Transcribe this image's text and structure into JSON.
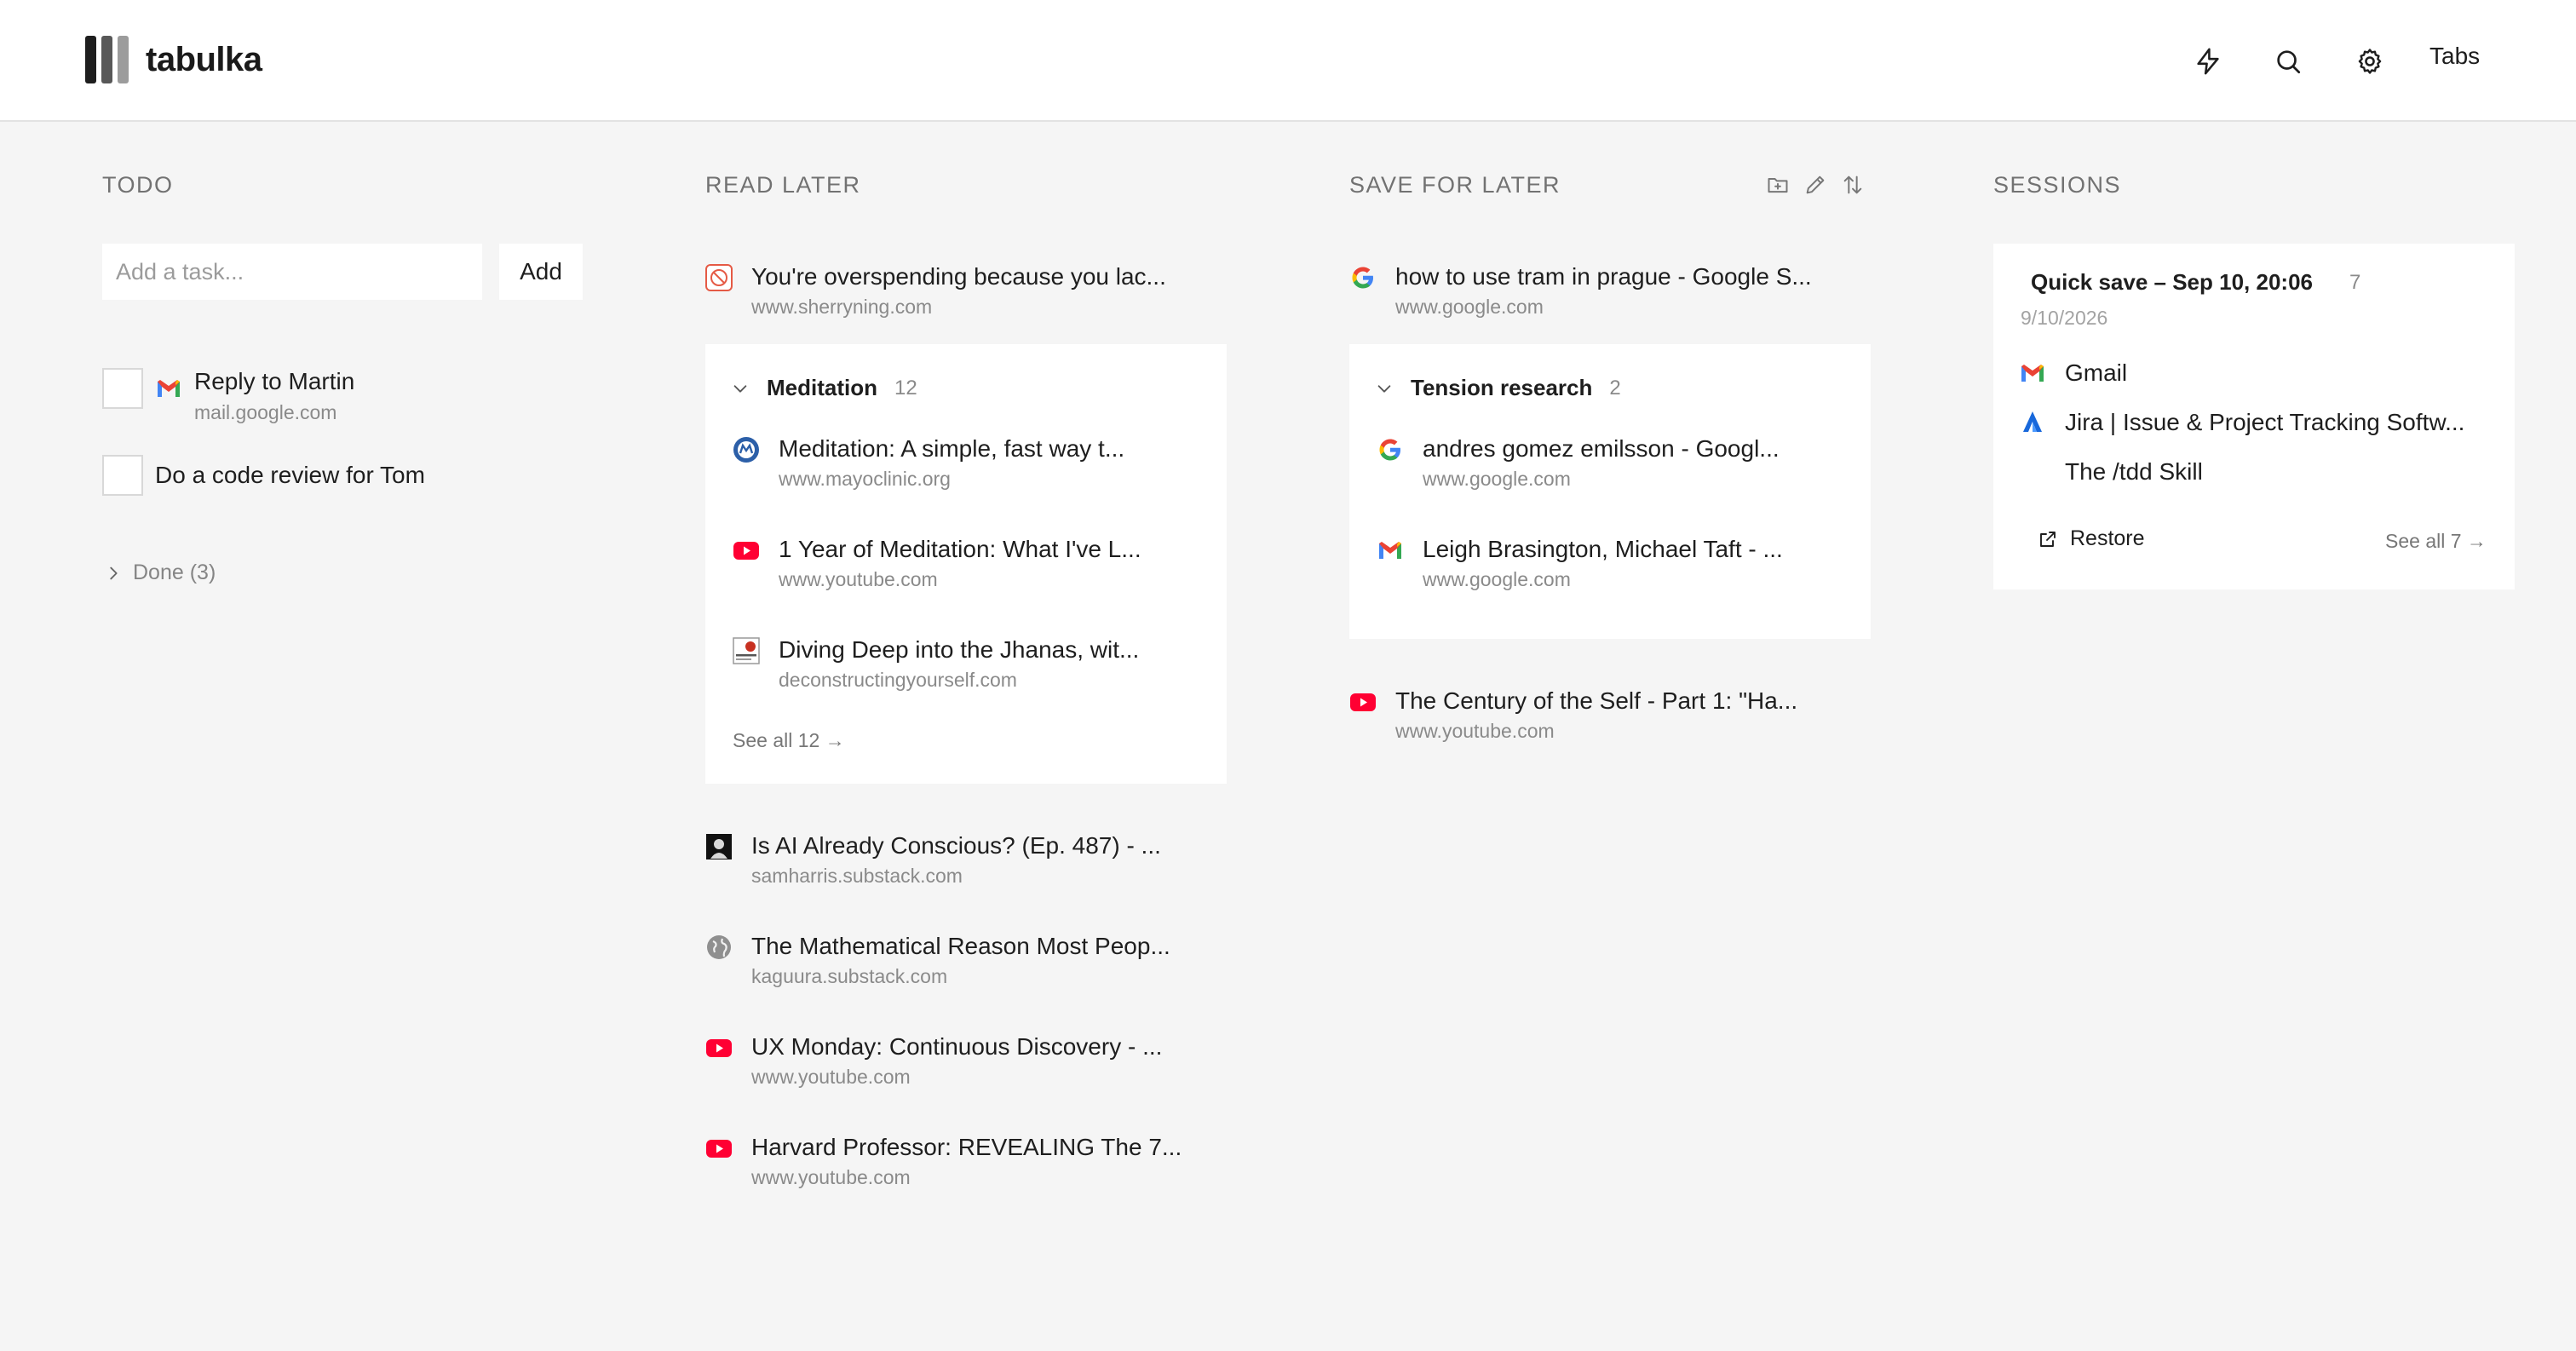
{
  "app": {
    "name": "tabulka",
    "brand_colors": [
      "#1e1e1e",
      "#585858",
      "#9c9c9c"
    ]
  },
  "header": {
    "icons": [
      "lightning-icon",
      "search-icon",
      "gear-icon"
    ],
    "tabs_label": "Tabs"
  },
  "todo": {
    "title": "TODO",
    "input_placeholder": "Add a task...",
    "add_label": "Add",
    "items": [
      {
        "title": "Reply to Martin",
        "domain": "mail.google.com",
        "icon": "gmail-icon"
      },
      {
        "title": "Do a code review for Tom",
        "domain": ""
      }
    ],
    "done_label": "Done (3)"
  },
  "read_later": {
    "title": "READ LATER",
    "items": [
      {
        "title": "You're overspending because you lac...",
        "domain": "www.sherryning.com",
        "icon": "sherryning-icon"
      },
      {
        "title": "Is AI Already Conscious? (Ep. 487) - ...",
        "domain": "samharris.substack.com",
        "icon": "samharris-icon"
      },
      {
        "title": "The Mathematical Reason Most Peop...",
        "domain": "kaguura.substack.com",
        "icon": "globe-icon"
      },
      {
        "title": "UX Monday: Continuous Discovery - ...",
        "domain": "www.youtube.com",
        "icon": "youtube-icon"
      },
      {
        "title": "Harvard Professor: REVEALING The 7...",
        "domain": "www.youtube.com",
        "icon": "youtube-icon"
      }
    ],
    "group": {
      "name": "Meditation",
      "count": "12",
      "items": [
        {
          "title": "Meditation: A simple, fast way t...",
          "domain": "www.mayoclinic.org",
          "icon": "mayoclinic-icon"
        },
        {
          "title": "1 Year of Meditation: What I've L...",
          "domain": "www.youtube.com",
          "icon": "youtube-icon"
        },
        {
          "title": "Diving Deep into the Jhanas, wit...",
          "domain": "deconstructingyourself.com",
          "icon": "deconstructing-icon"
        }
      ],
      "see_all": "See all 12 →"
    }
  },
  "save_for_later": {
    "title": "SAVE FOR LATER",
    "tools": [
      "folder-plus-icon",
      "pencil-icon",
      "sort-icon"
    ],
    "items": [
      {
        "title": "how to use tram in prague - Google S...",
        "domain": "www.google.com",
        "icon": "google-icon"
      },
      {
        "title": "The Century of the Self - Part 1: \"Ha...",
        "domain": "www.youtube.com",
        "icon": "youtube-icon"
      }
    ],
    "group": {
      "name": "Tension research",
      "count": "2",
      "items": [
        {
          "title": "andres gomez emilsson - Googl...",
          "domain": "www.google.com",
          "icon": "google-icon"
        },
        {
          "title": "Leigh Brasington, Michael Taft - ...",
          "domain": "www.google.com",
          "icon": "gmail-icon"
        }
      ]
    }
  },
  "sessions": {
    "title": "SESSIONS",
    "card": {
      "title": "Quick save – Sep 10, 20:06",
      "count": "7",
      "date": "9/10/2026",
      "items": [
        {
          "title": "Gmail",
          "icon": "gmail-icon"
        },
        {
          "title": "Jira | Issue & Project Tracking Softw...",
          "icon": "jira-icon"
        },
        {
          "title": "The /tdd Skill",
          "icon": ""
        }
      ],
      "restore_label": "Restore",
      "see_all": "See all 7 →"
    }
  }
}
